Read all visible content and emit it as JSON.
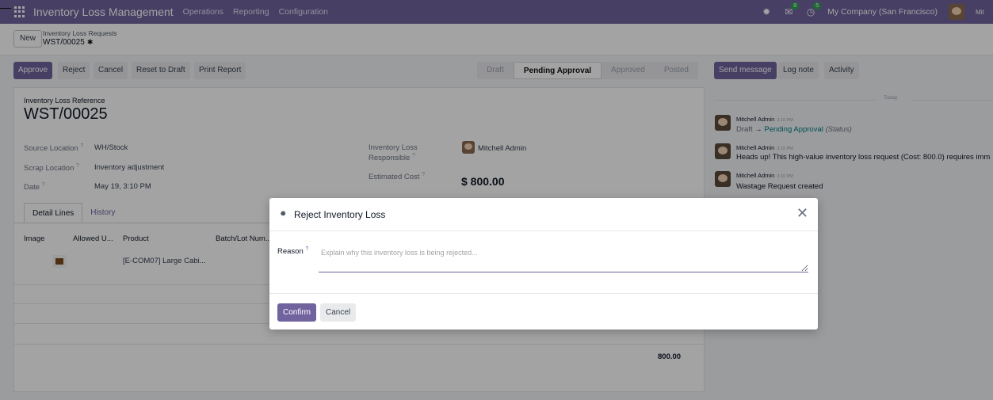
{
  "navbar": {
    "app_title": "Inventory Loss Management",
    "menus": [
      "Operations",
      "Reporting",
      "Configuration"
    ],
    "messages_count": "8",
    "activities_count": "5",
    "company": "My Company (San Francisco)",
    "user_short": "Mit"
  },
  "control": {
    "new_label": "New",
    "breadcrumb_parent": "Inventory Loss Requests",
    "breadcrumb_current": "WST/00025"
  },
  "actions": {
    "approve": "Approve",
    "reject": "Reject",
    "cancel": "Cancel",
    "reset": "Reset to Draft",
    "print": "Print Report"
  },
  "status": {
    "stages": [
      "Draft",
      "Pending Approval",
      "Approved",
      "Posted"
    ],
    "active": "Pending Approval"
  },
  "form": {
    "ref_label": "Inventory Loss Reference",
    "ref_value": "WST/00025",
    "source_location_label": "Source Location",
    "source_location_value": "WH/Stock",
    "scrap_location_label": "Scrap Location",
    "scrap_location_value": "Inventory adjustment",
    "date_label": "Date",
    "date_value": "May 19, 3:10 PM",
    "responsible_label_1": "Inventory Loss",
    "responsible_label_2": "Responsible",
    "responsible_value": "Mitchell Admin",
    "estimated_cost_label": "Estimated Cost",
    "estimated_cost_value": "$ 800.00"
  },
  "tabs": [
    "Detail Lines",
    "History"
  ],
  "table": {
    "headers": [
      "Image",
      "Allowed U...",
      "Product",
      "Batch/Lot Num..."
    ],
    "rows": [
      {
        "product": "[E-COM07] Large Cabi..."
      }
    ],
    "total": "800.00"
  },
  "chatter": {
    "send_message": "Send message",
    "log_note": "Log note",
    "activity": "Activity",
    "today": "Today",
    "messages": [
      {
        "author": "Mitchell Admin",
        "time": "3:10 PM",
        "from": "Draft",
        "arrow": "→",
        "to": "Pending Approval",
        "field": "(Status)"
      },
      {
        "author": "Mitchell Admin",
        "time": "3:10 PM",
        "body": "Heads up! This high-value inventory loss request (Cost: 800.0) requires imm"
      },
      {
        "author": "Mitchell Admin",
        "time": "3:10 PM",
        "body": "Wastage Request created"
      }
    ]
  },
  "dialog": {
    "title": "Reject Inventory Loss",
    "reason_label": "Reason",
    "reason_placeholder": "Explain why this inventory loss is being rejected...",
    "reason_value": "",
    "confirm": "Confirm",
    "cancel": "Cancel"
  },
  "colors": {
    "brand": "#71639e",
    "link": "#017e84",
    "badge": "#2ea44f"
  }
}
